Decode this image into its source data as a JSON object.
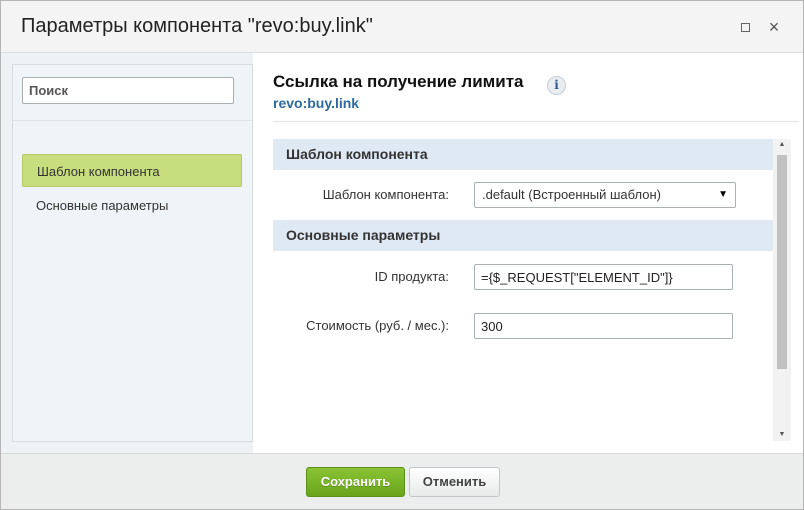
{
  "dialog": {
    "title": "Параметры компонента \"revo:buy.link\"",
    "maximize_icon": "maximize-icon",
    "close_icon": "close-icon",
    "close_glyph": "×"
  },
  "sidebar": {
    "search_placeholder": "Поиск",
    "search_value": "",
    "items": [
      {
        "label": "Шаблон компонента",
        "active": true
      },
      {
        "label": "Основные параметры",
        "active": false
      }
    ]
  },
  "main": {
    "heading": "Ссылка на получение лимита",
    "info_glyph": "i",
    "subheading": "revo:buy.link",
    "sections": [
      {
        "title": "Шаблон компонента",
        "fields": [
          {
            "label": "Шаблон компонента:",
            "value": ".default (Встроенный шаблон)",
            "type": "select"
          }
        ]
      },
      {
        "title": "Основные параметры",
        "fields": [
          {
            "label": "ID продукта:",
            "value": "={$_REQUEST[\"ELEMENT_ID\"]}",
            "type": "text"
          },
          {
            "label": "Стоимость (руб. / мес.):",
            "value": "300",
            "type": "text"
          }
        ]
      }
    ]
  },
  "footer": {
    "save_label": "Сохранить",
    "cancel_label": "Отменить"
  },
  "colors": {
    "active_item": "#c6de7d",
    "section_bar": "#dfe9f3",
    "save_button": "#7ab52a",
    "subheading": "#2e6b9c"
  }
}
